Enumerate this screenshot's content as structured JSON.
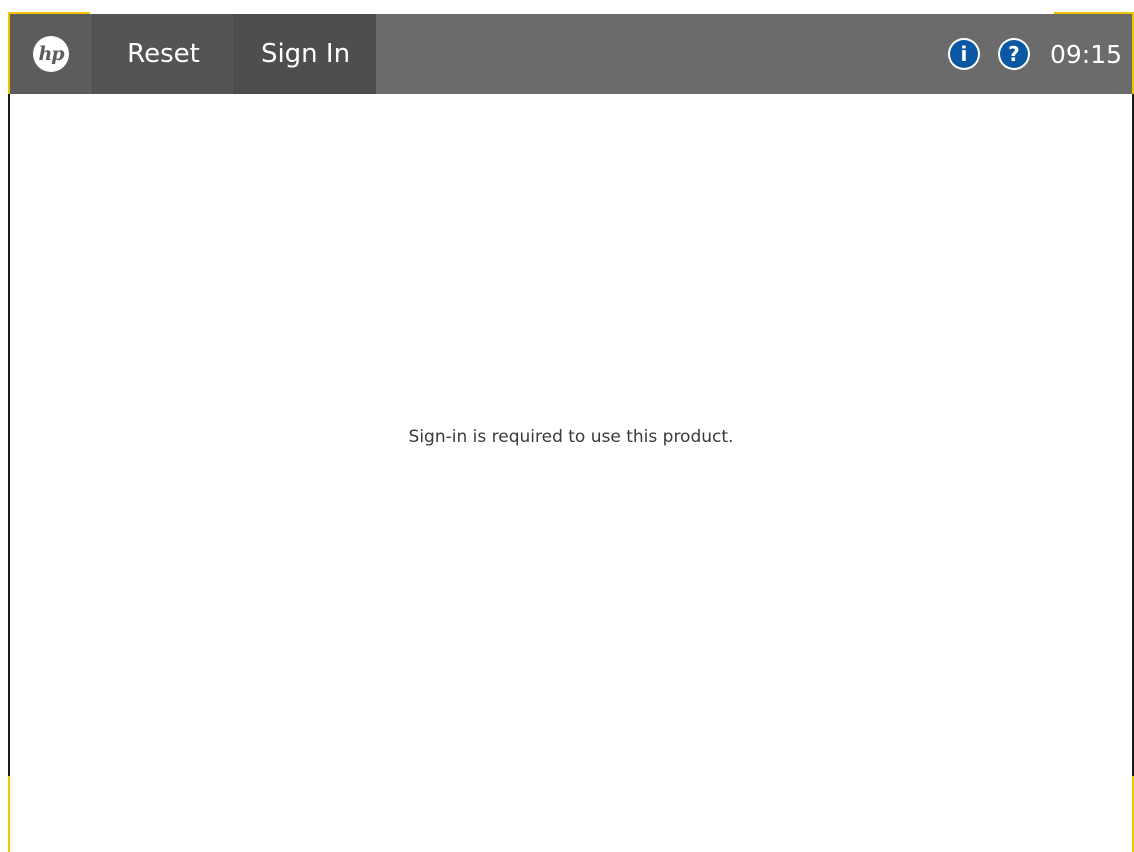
{
  "header": {
    "logo_text": "hp",
    "reset_label": "Reset",
    "sign_in_label": "Sign In",
    "info_symbol": "i",
    "help_symbol": "?",
    "time": "09:15"
  },
  "main": {
    "message": "Sign-in is required to use this product."
  },
  "icons": {
    "home": "hp-logo-icon",
    "info": "info-icon",
    "help": "help-icon"
  },
  "colors": {
    "topbar": "#6b6b6b",
    "accent": "#f2c500",
    "icon_blue": "#0a57a3"
  }
}
